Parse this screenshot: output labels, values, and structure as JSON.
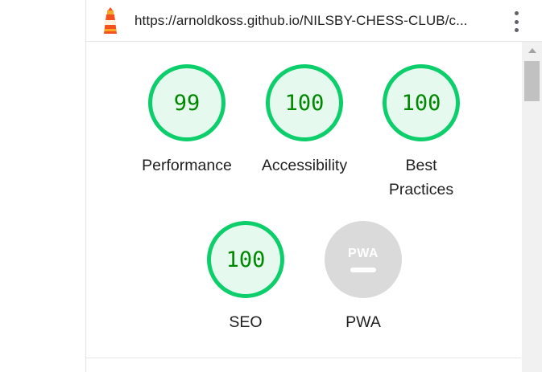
{
  "header": {
    "url": "https://arnoldkoss.github.io/NILSBY-CHESS-CLUB/c...",
    "logo_icon": "lighthouse-icon",
    "menu_icon": "more-vert-icon"
  },
  "gauges": [
    {
      "label": "Performance",
      "score": "99",
      "color": "#0cce6b"
    },
    {
      "label": "Accessibility",
      "score": "100",
      "color": "#0cce6b"
    },
    {
      "label_line1": "Best",
      "label_line2": "Practices",
      "score": "100",
      "color": "#0cce6b"
    },
    {
      "label": "SEO",
      "score": "100",
      "color": "#0cce6b"
    },
    {
      "label": "PWA",
      "badge_text": "PWA",
      "color": "#dadada"
    }
  ],
  "colors": {
    "pass_ring": "#0cce6b",
    "pass_fill": "#e6f9ef",
    "pass_text": "#008800",
    "neutral": "#dadada"
  }
}
